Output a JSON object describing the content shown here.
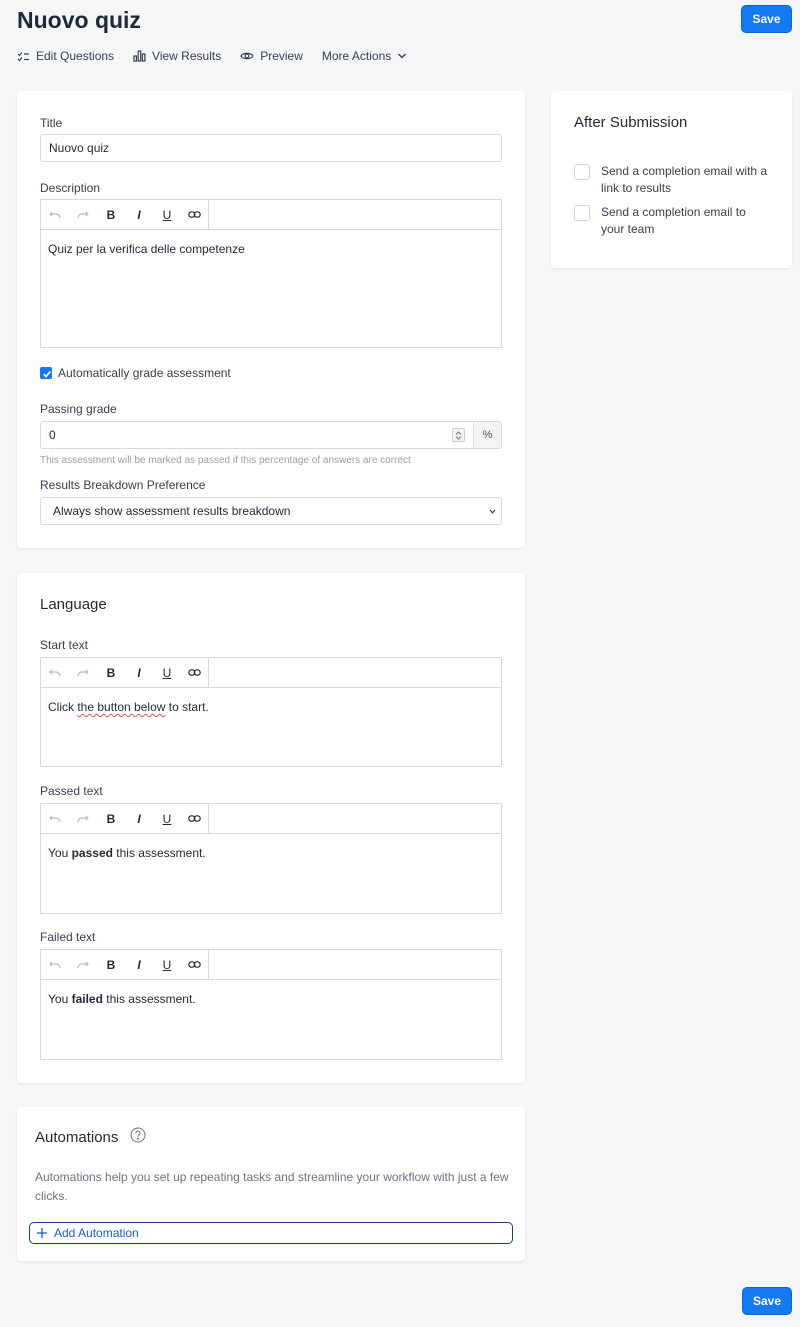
{
  "page": {
    "title": "Nuovo quiz",
    "save_label": "Save"
  },
  "toolbar": {
    "edit_questions": "Edit Questions",
    "view_results": "View Results",
    "preview": "Preview",
    "more_actions": "More Actions"
  },
  "main": {
    "title_label": "Title",
    "title_value": "Nuovo quiz",
    "description_label": "Description",
    "description_value": "Quiz per la verifica delle competenze",
    "auto_grade_label": "Automatically grade assessment",
    "auto_grade_checked": true,
    "passing_grade_label": "Passing grade",
    "passing_grade_value": "0",
    "passing_grade_unit": "%",
    "passing_grade_hint": "This assessment will be marked as passed if this percentage of answers are correct",
    "results_pref_label": "Results Breakdown Preference",
    "results_pref_value": "Always show assessment results breakdown"
  },
  "editor_tools": {
    "bold": "B",
    "italic": "I",
    "underline": "U"
  },
  "after": {
    "title": "After Submission",
    "option1": "Send a completion email with a link to results",
    "option2": "Send a completion email to your team"
  },
  "language": {
    "title": "Language",
    "start_label": "Start text",
    "start_before": "Click ",
    "start_squiggle": "the button below",
    "start_after": " to start.",
    "passed_label": "Passed text",
    "passed_pre": "You ",
    "passed_bold": "passed",
    "passed_post": " this assessment.",
    "failed_label": "Failed text",
    "failed_pre": "You ",
    "failed_bold": "failed",
    "failed_post": " this assessment."
  },
  "automations": {
    "title": "Automations",
    "description": "Automations help you set up repeating tasks and streamline your workflow with just a few clicks.",
    "add_label": "Add Automation"
  },
  "colors": {
    "primary": "#1479f2",
    "link": "#1d5bc4",
    "border_focus": "#1c3b8c"
  }
}
